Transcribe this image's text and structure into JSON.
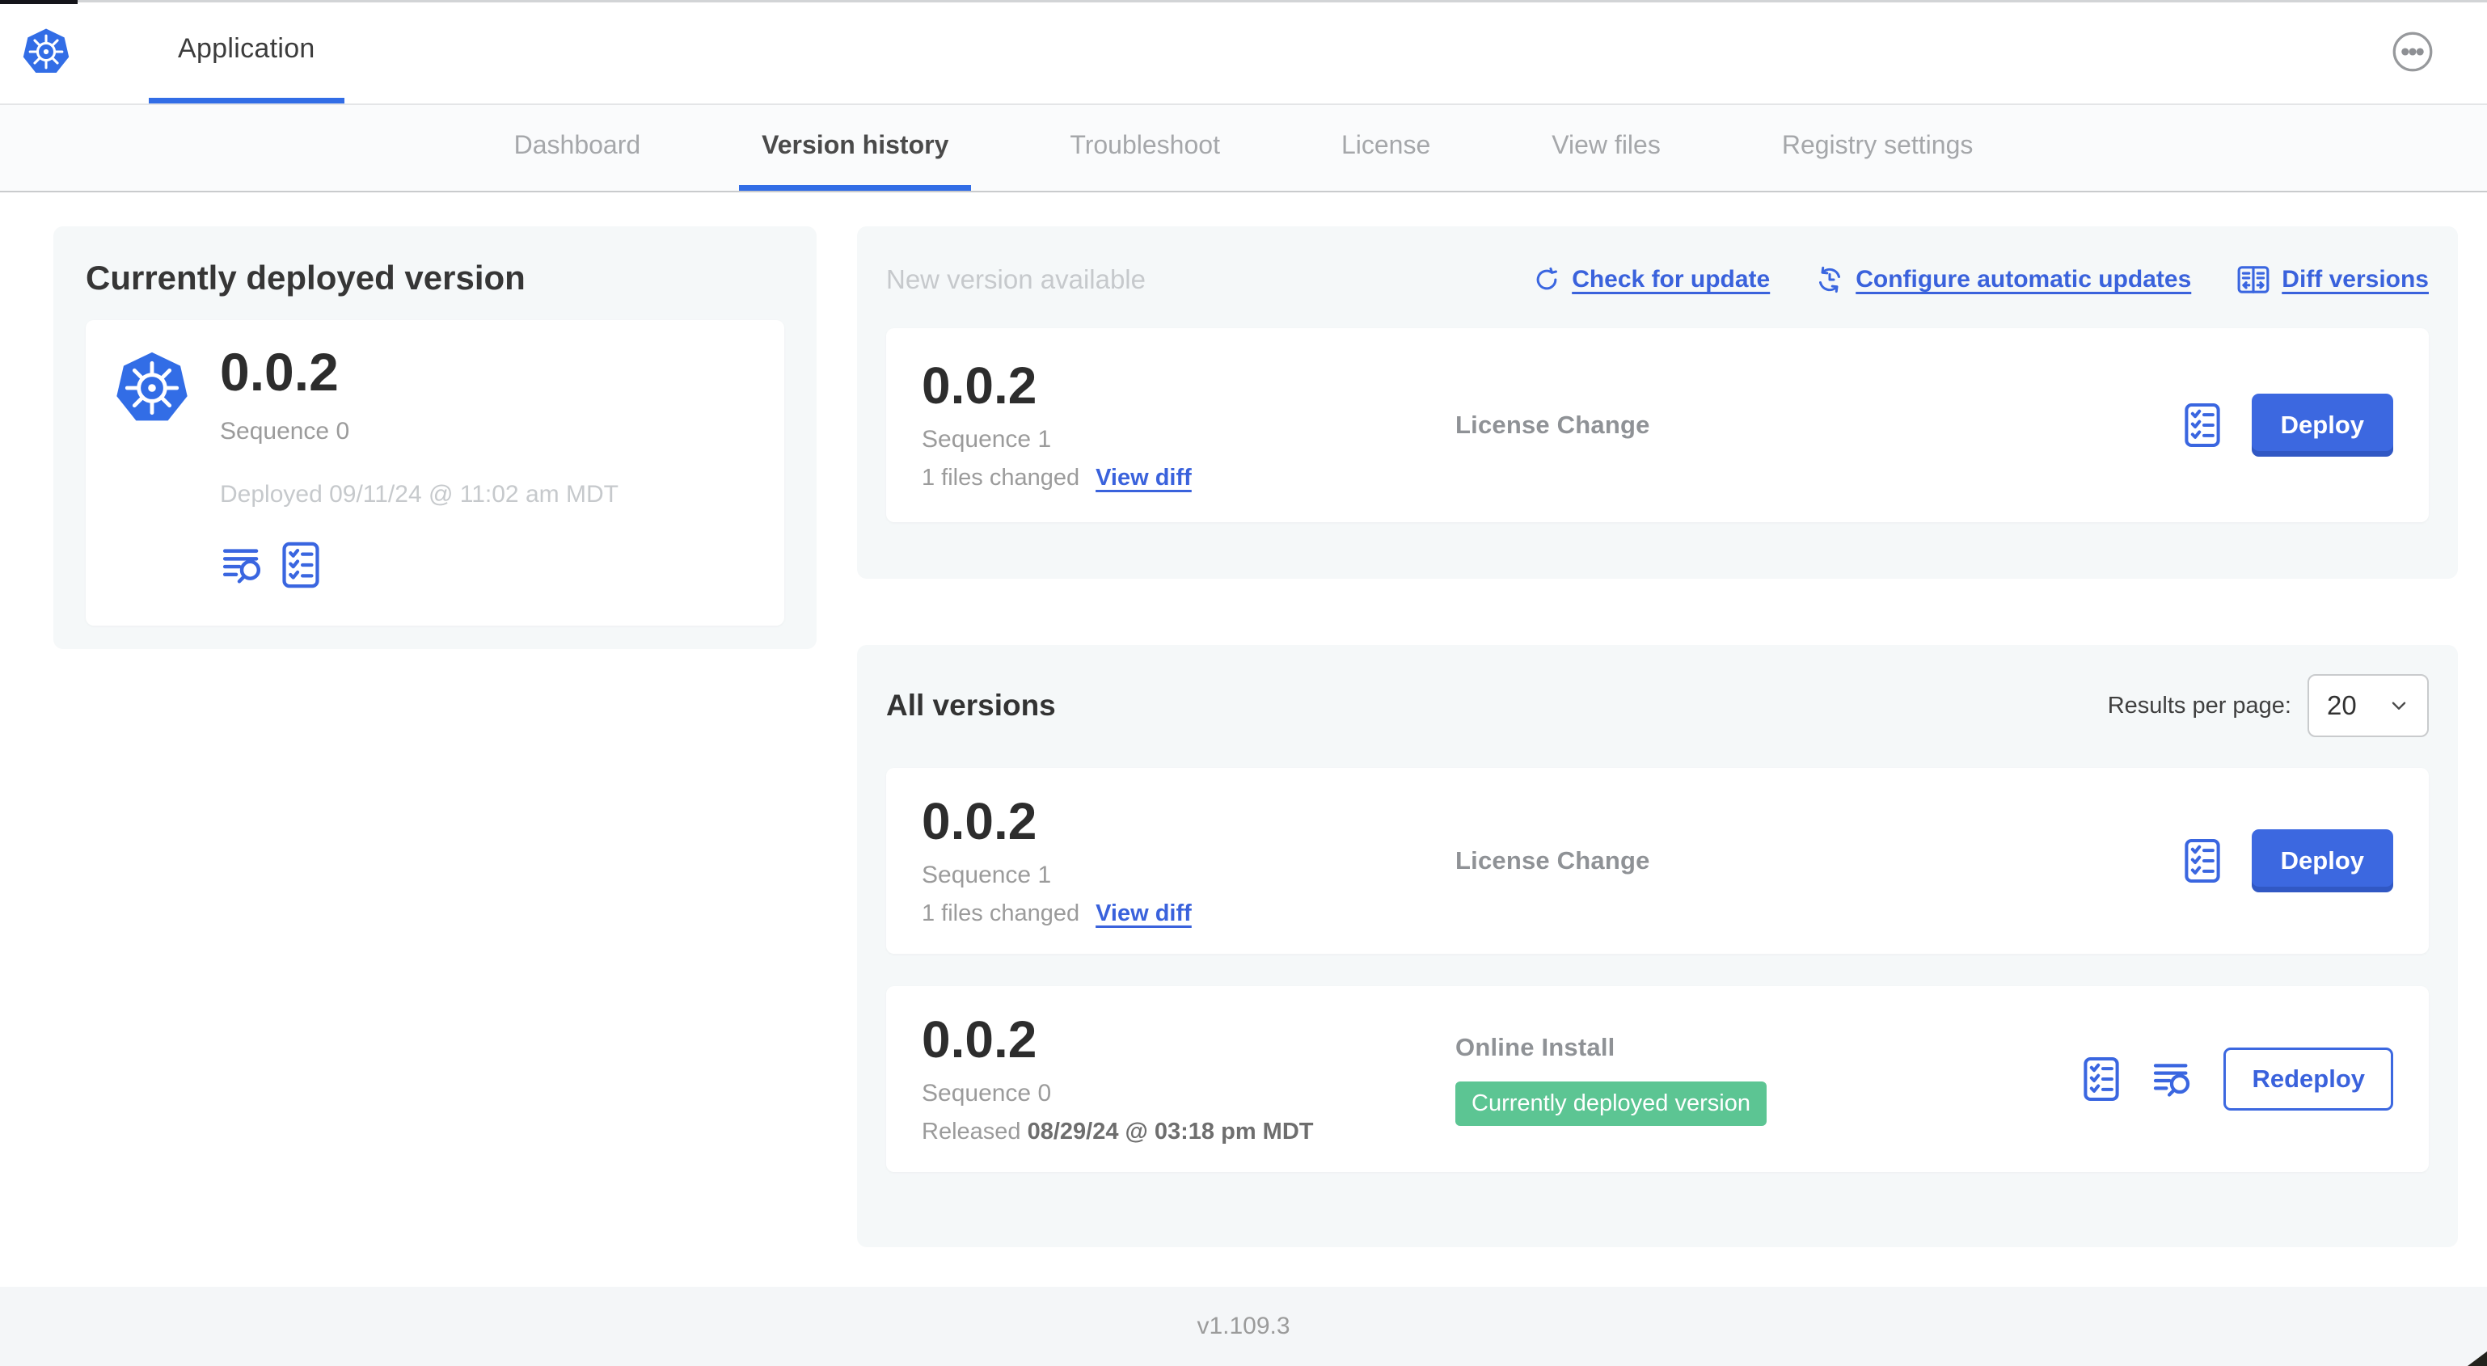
{
  "colors": {
    "accent_blue": "#3a66e0",
    "k8s_blue": "#326de6",
    "badge_green": "#5cc593",
    "panel_bg": "#f5f8f9"
  },
  "header": {
    "app_tab": "Application",
    "menu_icon": "ellipsis-icon"
  },
  "nav": {
    "tabs": [
      "Dashboard",
      "Version history",
      "Troubleshoot",
      "License",
      "View files",
      "Registry settings"
    ],
    "active_tab": "Version history"
  },
  "current_version_panel": {
    "title": "Currently deployed version",
    "version": "0.0.2",
    "sequence": "Sequence 0",
    "deployed": "Deployed 09/11/24 @ 11:02 am MDT",
    "icons": [
      "logs-icon",
      "checklist-icon"
    ]
  },
  "new_version_panel": {
    "title": "New version available",
    "actions": {
      "check": "Check for update",
      "configure": "Configure automatic updates",
      "diff": "Diff versions"
    },
    "card": {
      "version": "0.0.2",
      "sequence": "Sequence 1",
      "files_changed": "1 files changed",
      "view_diff": "View diff",
      "source": "License Change",
      "deploy": "Deploy"
    }
  },
  "all_versions_panel": {
    "title": "All versions",
    "results_per_page_label": "Results per page:",
    "results_per_page_value": "20",
    "rows": [
      {
        "version": "0.0.2",
        "sequence": "Sequence 1",
        "files_changed": "1 files changed",
        "view_diff": "View diff",
        "source": "License Change",
        "action": "Deploy"
      },
      {
        "version": "0.0.2",
        "sequence": "Sequence 0",
        "released_label": "Released",
        "released_date": "08/29/24 @ 03:18 pm MDT",
        "source": "Online Install",
        "badge": "Currently deployed version",
        "action": "Redeploy"
      }
    ]
  },
  "footer": {
    "app_version": "v1.109.3"
  }
}
